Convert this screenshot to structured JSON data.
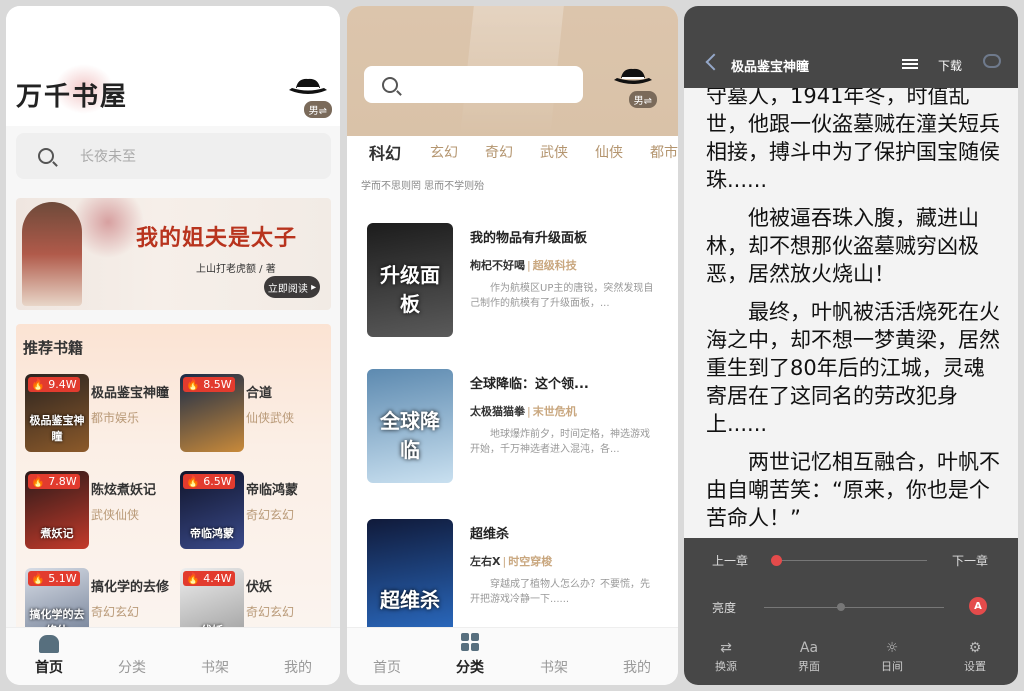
{
  "panel1": {
    "logo": "万千书屋",
    "gender": "男⇌",
    "search_placeholder": "长夜未至",
    "banner": {
      "title": "我的姐夫是太子",
      "author": "上山打老虎额 / 著",
      "button": "立即阅读"
    },
    "recommend_title": "推荐书籍",
    "books": [
      {
        "name": "极品鉴宝神瞳",
        "category": "都市娱乐",
        "heat": "9.4W",
        "cover_text": "极品鉴宝神瞳",
        "colors": [
          "#2a2320",
          "#8c5a2a"
        ]
      },
      {
        "name": "合道",
        "category": "仙侠武侠",
        "heat": "8.5W",
        "cover_text": "",
        "colors": [
          "#182a48",
          "#c98a3a"
        ]
      },
      {
        "name": "陈炫煮妖记",
        "category": "武侠仙侠",
        "heat": "7.8W",
        "cover_text": "煮妖记",
        "colors": [
          "#2a1a1a",
          "#c43a2a"
        ]
      },
      {
        "name": "帝临鸿蒙",
        "category": "奇幻玄幻",
        "heat": "6.5W",
        "cover_text": "帝临鸿蒙",
        "colors": [
          "#10142a",
          "#3a4a8a"
        ]
      },
      {
        "name": "搞化学的去修",
        "category": "奇幻玄幻",
        "heat": "5.1W",
        "cover_text": "搞化学的去修仙",
        "colors": [
          "#d8dde6",
          "#6a7890"
        ]
      },
      {
        "name": "伏妖",
        "category": "奇幻玄幻",
        "heat": "4.4W",
        "cover_text": "伏妖",
        "colors": [
          "#eeeeee",
          "#9a9a9a"
        ]
      }
    ],
    "tabs": [
      "首页",
      "分类",
      "书架",
      "我的"
    ],
    "active_tab": "首页"
  },
  "panel2": {
    "gender": "男⇌",
    "search_placeholder": "",
    "categories": [
      "科幻",
      "玄幻",
      "奇幻",
      "武侠",
      "仙侠",
      "都市"
    ],
    "active_category": "科幻",
    "motto": "学而不思则罔 思而不学则殆",
    "books": [
      {
        "title": "我的物品有升级面板",
        "author": "枸杞不好喝",
        "genre": "超级科技",
        "desc": "作为航模区UP主的唐锐，突然发现自己制作的航模有了升级面板，...",
        "cover_text": "升级面板",
        "colors": [
          "#1c1c1c",
          "#5a5a5a"
        ]
      },
      {
        "title": "全球降临：这个领...",
        "author": "太极猫猫拳",
        "genre": "末世危机",
        "desc": "地球爆炸前夕，时间定格，神选游戏开始，千万神选者进入混沌，各...",
        "cover_text": "全球降临",
        "colors": [
          "#5d8ab0",
          "#c9e0f0"
        ]
      },
      {
        "title": "超维杀",
        "author": "左右X",
        "genre": "时空穿梭",
        "desc": "穿越成了植物人怎么办？不要慌，先开把游戏冷静一下......",
        "cover_text": "超维杀",
        "colors": [
          "#101a3a",
          "#2a6ac0"
        ]
      }
    ],
    "tabs": [
      "首页",
      "分类",
      "书架",
      "我的"
    ],
    "active_tab": "分类"
  },
  "panel3": {
    "title": "极品鉴宝神瞳",
    "download": "下载",
    "paragraphs": [
      "守墓人，1941年冬，时值乱世，他跟一伙盗墓贼在潼关短兵相接，搏斗中为了保护国宝随侯珠......",
      "他被逼吞珠入腹，藏进山林，却不想那伙盗墓贼穷凶极恶，居然放火烧山！",
      "最终，叶帆被活活烧死在火海之中，却不想一梦黄梁，居然重生到了80年后的江城，灵魂寄居在了这同名的劳改犯身上......",
      "两世记忆相互融合，叶帆不由自嘲苦笑：“原来，你也是个苦命人！”"
    ],
    "prev_chapter": "上一章",
    "next_chapter": "下一章",
    "chapter_progress": 0.02,
    "brightness_label": "亮度",
    "brightness": 0.43,
    "auto_label": "A",
    "buttons": [
      {
        "label": "换源",
        "glyph": "⇄"
      },
      {
        "label": "界面",
        "glyph": "Aa"
      },
      {
        "label": "日间",
        "glyph": "☼"
      },
      {
        "label": "设置",
        "glyph": "⚙"
      }
    ]
  }
}
